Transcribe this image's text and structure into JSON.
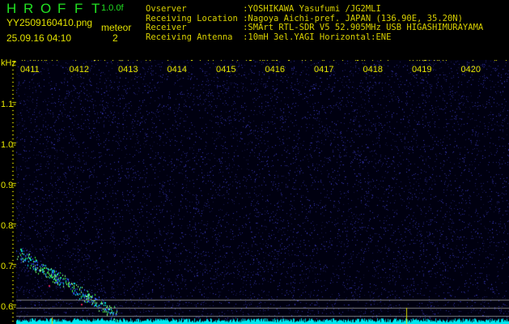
{
  "app": {
    "title_letters": [
      "H",
      "R",
      "O",
      "F",
      "F",
      "T"
    ],
    "version": "1.0.0f",
    "filename": "YY2509160410.png",
    "datetime": "25.09.16 04:10",
    "mode": "meteor",
    "count": "2"
  },
  "info": [
    {
      "label": "Ovserver           ",
      "value": ":YOSHIKAWA Yasufumi /JG2MLI"
    },
    {
      "label": "Receiving Location ",
      "value": ":Nagoya Aichi-pref. JAPAN (136.90E, 35.20N)"
    },
    {
      "label": "Receiver           ",
      "value": ":SMArt RTL-SDR V5 52.905MHz USB HIGASHIMURAYAMA"
    },
    {
      "label": "Receiving Antenna  ",
      "value": ":10mH 3el.YAGI Horizontal:ENE"
    }
  ],
  "axis": {
    "unit": "kHz",
    "y_ticks": [
      "1.1",
      "1.0",
      "0.9",
      "0.8",
      "0.7",
      "0.6"
    ],
    "time_ticks": [
      "0411",
      "0412",
      "0413",
      "0414",
      "0415",
      "0416",
      "0417",
      "0418",
      "0419",
      "0420"
    ]
  }
}
